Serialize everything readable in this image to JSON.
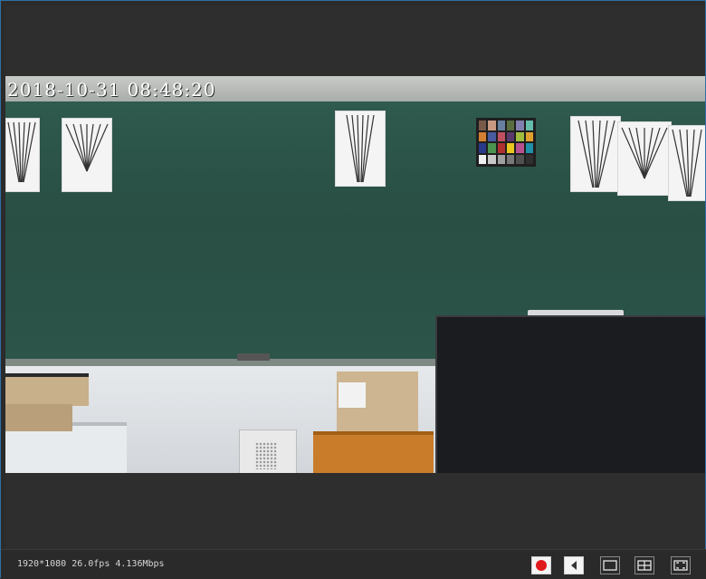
{
  "overlay": {
    "timestamp": "2018-10-31 08:48:20"
  },
  "statusbar": {
    "stream_info": "1920*1080 26.0fps 4.136Mbps"
  },
  "controls": {
    "record": "record-button",
    "audio": "audio-button",
    "single_view": "single-view-button",
    "quad_view": "quad-view-button",
    "fullscreen": "fullscreen-button"
  },
  "colors": {
    "border_accent": "#2f6fa8",
    "record_red": "#e0191b",
    "background": "#2b2b2b"
  }
}
